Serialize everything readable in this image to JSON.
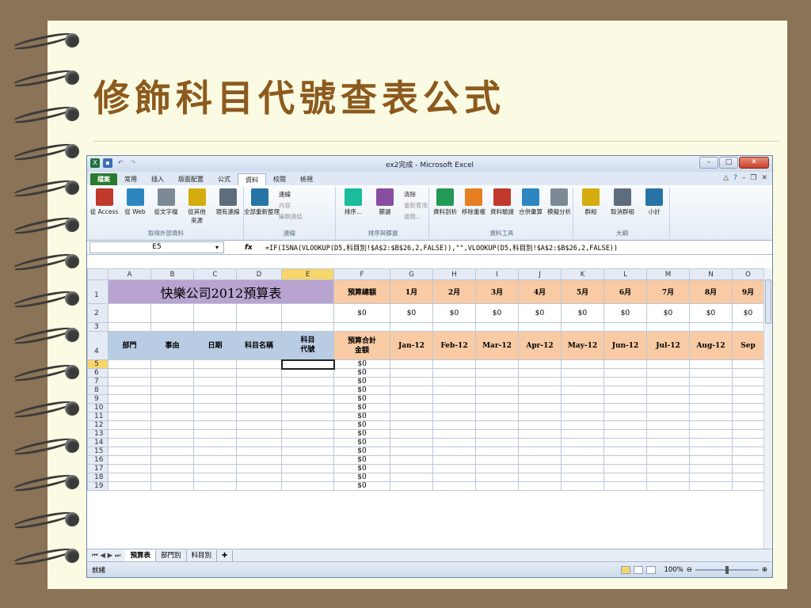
{
  "slide": {
    "title": "修飾科目代號查表公式"
  },
  "window": {
    "title": "ex2完成 - Microsoft Excel",
    "min": "–",
    "max": "□",
    "close": "✕"
  },
  "tabs": [
    "檔案",
    "常用",
    "插入",
    "版面配置",
    "公式",
    "資料",
    "校閱",
    "檢視"
  ],
  "active_tab": "資料",
  "ribbon": {
    "groups": [
      {
        "label": "取得外部資料",
        "buttons": [
          "從 Access",
          "從 Web",
          "從文字檔",
          "從其他\n來源",
          "現有連線"
        ]
      },
      {
        "label": "連線",
        "buttons": [
          "全部重新整理"
        ],
        "small": [
          "連線",
          "內容",
          "編輯連結"
        ]
      },
      {
        "label": "排序與篩選",
        "buttons": [
          "排序...",
          "篩選"
        ],
        "small": [
          "清除",
          "重新套用",
          "進階..."
        ]
      },
      {
        "label": "資料工具",
        "buttons": [
          "資料剖析",
          "移除重複",
          "資料驗證",
          "合併彙算",
          "模擬分析"
        ]
      },
      {
        "label": "大綱",
        "buttons": [
          "群組",
          "取消群組",
          "小計"
        ]
      }
    ]
  },
  "formula_bar": {
    "name_box": "E5",
    "fx": "fx",
    "formula": "=IF(ISNA(VLOOKUP(D5,科目別!$A$2:$B$26,2,FALSE)),\"\",VLOOKUP(D5,科目別!$A$2:$B$26,2,FALSE))"
  },
  "columns": [
    "A",
    "B",
    "C",
    "D",
    "E",
    "F",
    "G",
    "H",
    "I",
    "J",
    "K",
    "L",
    "M",
    "N",
    "O"
  ],
  "selected_column": "E",
  "sheet": {
    "title": "快樂公司2012預算表",
    "total_label": "預算總額",
    "months": [
      "1月",
      "2月",
      "3月",
      "4月",
      "5月",
      "6月",
      "7月",
      "8月",
      "9月"
    ],
    "row2_values": [
      "$0",
      "$0",
      "$0",
      "$0",
      "$0",
      "$0",
      "$0",
      "$0",
      "$0",
      "$0"
    ],
    "headers": [
      "部門",
      "事由",
      "日期",
      "科目名稱",
      "科目\n代號",
      "預算合計\n金額",
      "Jan-12",
      "Feb-12",
      "Mar-12",
      "Apr-12",
      "May-12",
      "Jun-12",
      "Jul-12",
      "Aug-12",
      "Sep"
    ],
    "data_rows": [
      {
        "row": "5",
        "total": "$0"
      },
      {
        "row": "6",
        "total": "$0"
      },
      {
        "row": "7",
        "total": "$0"
      },
      {
        "row": "8",
        "total": "$0"
      },
      {
        "row": "9",
        "total": "$0"
      },
      {
        "row": "10",
        "total": "$0"
      },
      {
        "row": "11",
        "total": "$0"
      },
      {
        "row": "12",
        "total": "$0"
      },
      {
        "row": "13",
        "total": "$0"
      },
      {
        "row": "14",
        "total": "$0"
      },
      {
        "row": "15",
        "total": "$0"
      },
      {
        "row": "16",
        "total": "$0"
      },
      {
        "row": "17",
        "total": "$0"
      },
      {
        "row": "18",
        "total": "$0"
      },
      {
        "row": "19",
        "total": "$0"
      }
    ]
  },
  "sheet_tabs": [
    "預算表",
    "部門別",
    "科目別"
  ],
  "active_sheet": "預算表",
  "status": {
    "ready": "就緒",
    "zoom": "100%"
  },
  "colors": {
    "title_band": "#b9a3d1",
    "month_header": "#f8cba5",
    "header_blue": "#b8cce4",
    "accent_title": "#8c5a1e"
  }
}
